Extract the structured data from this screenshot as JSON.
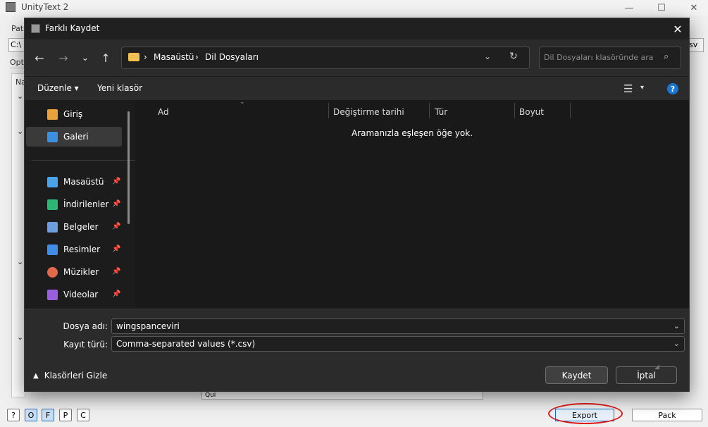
{
  "app": {
    "title": "UnityText 2",
    "window_controls": {
      "minimize": "—",
      "maximize": "☐",
      "close": "✕"
    },
    "partial_labels": {
      "path": "Path",
      "options": "Opt",
      "path_value": "C:\\",
      "name_col": "Na",
      "csv_btn": "sv"
    },
    "bottom_buttons": [
      "?",
      "O",
      "F",
      "P",
      "C"
    ],
    "export_label": "Export",
    "pack_label": "Pack",
    "partial_field": "Qui"
  },
  "dialog": {
    "title": "Farklı Kaydet",
    "close": "✕",
    "nav": {
      "back": "←",
      "forward": "→",
      "recent": "⌄",
      "up": "↑"
    },
    "breadcrumb": [
      "Masaüstü",
      "Dil Dosyaları"
    ],
    "breadcrumb_sep": "›",
    "search_placeholder": "Dil Dosyaları klasöründe ara",
    "toolbar": {
      "organize": "Düzenle ▾",
      "new_folder": "Yeni klasör",
      "help": "?"
    },
    "sidebar": {
      "items": [
        {
          "label": "Giriş",
          "color": "#e9a23b"
        },
        {
          "label": "Galeri",
          "color": "#3b8fe0"
        },
        {
          "label": "Masaüstü",
          "color": "#4aa3e8"
        },
        {
          "label": "İndirilenler",
          "color": "#2bb673"
        },
        {
          "label": "Belgeler",
          "color": "#6d9fe0"
        },
        {
          "label": "Resimler",
          "color": "#3e8ee8"
        },
        {
          "label": "Müzikler",
          "color": "#e06a4a"
        },
        {
          "label": "Videolar",
          "color": "#9a5fe0"
        }
      ],
      "pin": "📌"
    },
    "columns": [
      "Ad",
      "Değiştirme tarihi",
      "Tür",
      "Boyut"
    ],
    "empty_message": "Aramanızla eşleşen öğe yok.",
    "filename_label": "Dosya adı:",
    "filename_value": "wingspanceviri",
    "filetype_label": "Kayıt türü:",
    "filetype_value": "Comma-separated values (*.csv)",
    "hide_folders": "Klasörleri Gizle",
    "save": "Kaydet",
    "cancel": "İptal"
  },
  "colors": {
    "dialog_bg": "#202020",
    "accent": "#0078d7",
    "highlight": "#e01818"
  }
}
